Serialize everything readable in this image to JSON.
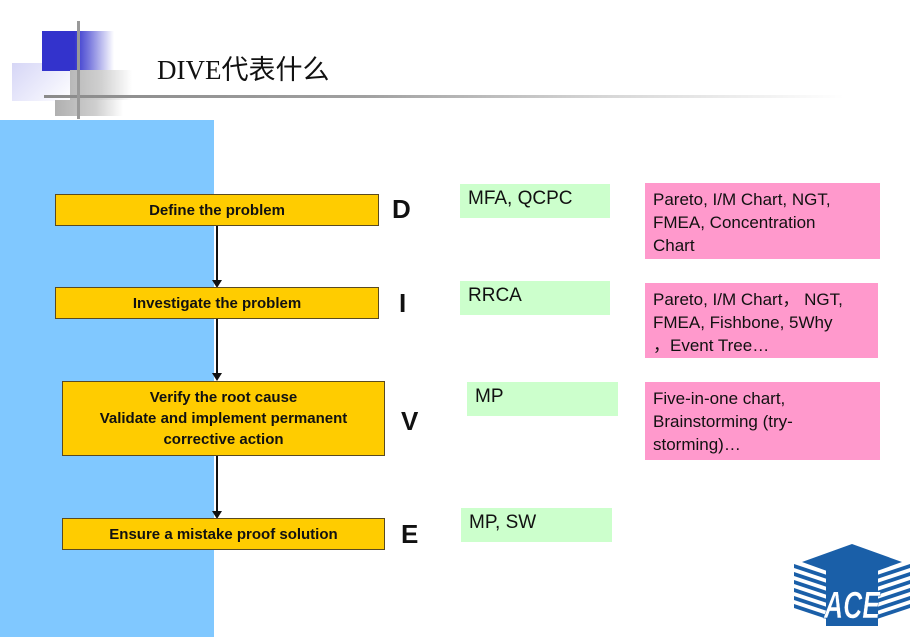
{
  "title": "DIVE代表什么",
  "steps": [
    {
      "letter": "D",
      "label_lines": [
        "Define the problem"
      ],
      "tools": "MFA, QCPC",
      "techniques": [
        "Pareto, I/M Chart, NGT,",
        "FMEA, Concentration",
        "Chart"
      ]
    },
    {
      "letter": "I",
      "label_lines": [
        "Investigate the problem"
      ],
      "tools": "RRCA",
      "techniques": [
        "Pareto, I/M Chart， NGT,",
        "FMEA, Fishbone, 5Why",
        "，Event Tree…"
      ]
    },
    {
      "letter": "V",
      "label_lines": [
        "Verify the root cause",
        "Validate and implement permanent",
        "corrective action"
      ],
      "tools": "MP",
      "techniques": [
        "Five-in-one chart,",
        "Brainstorming (try-",
        "storming)…"
      ]
    },
    {
      "letter": "E",
      "label_lines": [
        "Ensure a mistake proof solution"
      ],
      "tools": "MP, SW",
      "techniques": []
    }
  ],
  "logo": {
    "text": "ACE"
  },
  "colors": {
    "step_fill": "#ffcc00",
    "tool_fill": "#ccffcc",
    "technique_fill": "#ff99cc",
    "panel": "#80c8ff",
    "logo_blue": "#1a5fa8"
  }
}
